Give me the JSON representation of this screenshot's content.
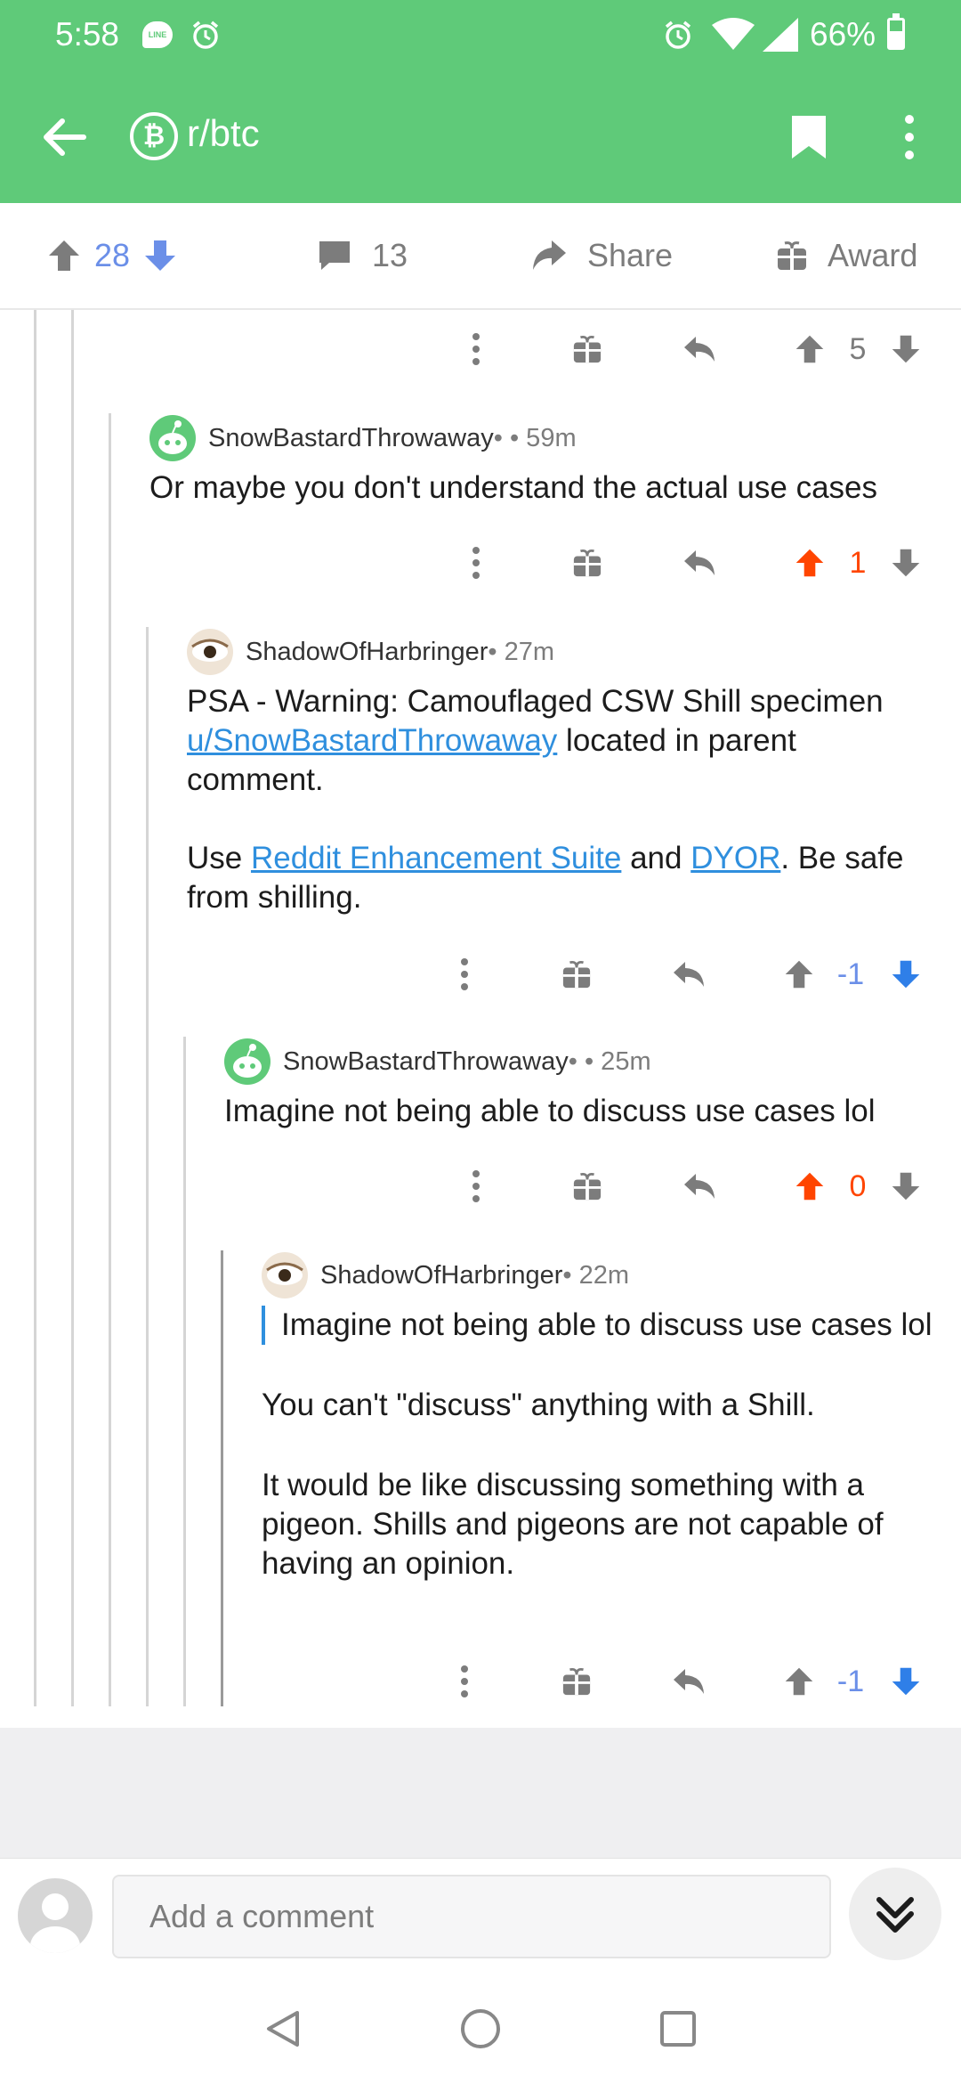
{
  "status_bar": {
    "time": "5:58",
    "line_badge": "LINE",
    "battery": "66%"
  },
  "app_bar": {
    "subreddit": "r/btc",
    "subreddit_icon_glyph": "₿"
  },
  "post_actions": {
    "score": "28",
    "comments": "13",
    "share_label": "Share",
    "award_label": "Award"
  },
  "comments": [
    {
      "score": "5"
    },
    {
      "author": "SnowBastardThrowaway",
      "meta": " • • 59m",
      "body": "Or maybe you don't understand the actual use cases",
      "score": "1"
    },
    {
      "author": "ShadowOfHarbringer",
      "meta": " • 27m",
      "body_p1_pre": "PSA - Warning: Camouflaged CSW Shill specimen ",
      "body_p1_link": "u/SnowBastardThrowaway",
      "body_p1_post": " located in parent comment.",
      "body_p2_pre": "Use ",
      "body_p2_link1": "Reddit Enhancement Suite",
      "body_p2_mid": " and ",
      "body_p2_link2": "DYOR",
      "body_p2_post": ". Be safe from shilling.",
      "score": "-1"
    },
    {
      "author": "SnowBastardThrowaway",
      "meta": " • • 25m",
      "body": "Imagine not being able to discuss use cases lol",
      "score": "0"
    },
    {
      "author": "ShadowOfHarbringer",
      "meta": " • 22m",
      "quote": "Imagine not being able to discuss use cases lol",
      "body_p1": "You can't \"discuss\" anything with a Shill.",
      "body_p2": "It would be like discussing something with a pigeon. Shills and pigeons are not capable of having an opinion.",
      "score": "-1"
    }
  ],
  "composer": {
    "placeholder": "Add a comment"
  },
  "colors": {
    "app_green": "#5fca79",
    "upvote_orange": "#ff4500",
    "downvote_blue": "#6b8fe8",
    "link_blue": "#2f8fde"
  }
}
